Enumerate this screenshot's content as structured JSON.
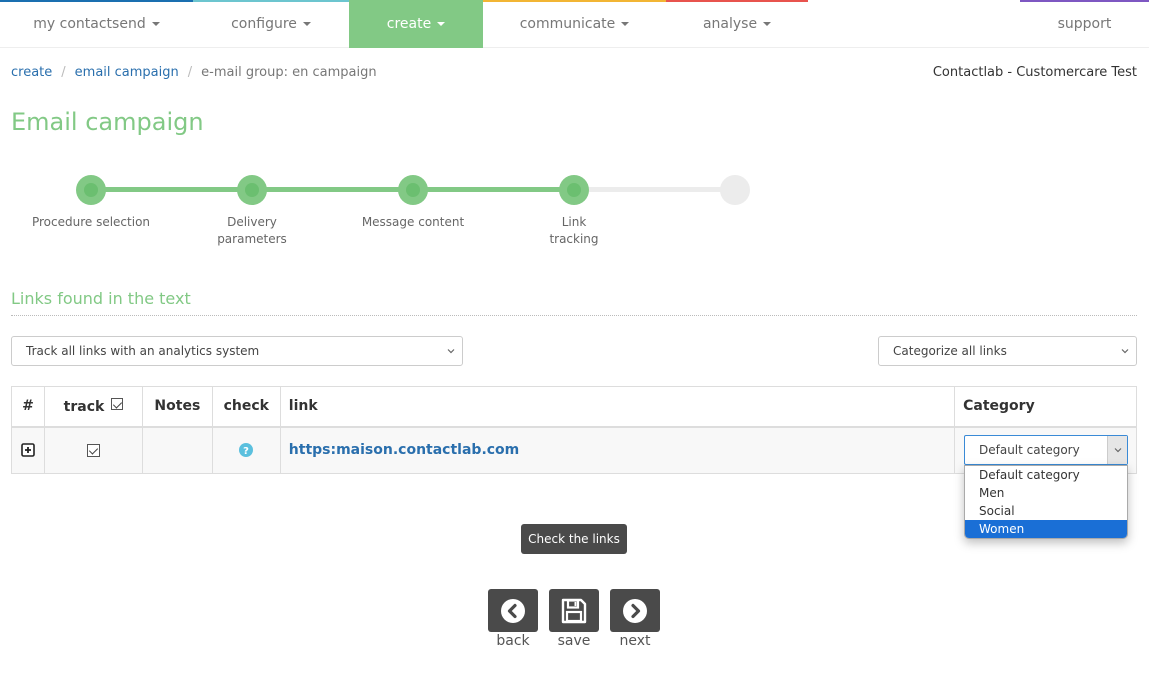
{
  "nav": {
    "items": [
      {
        "label": "my contactsend",
        "has_caret": true,
        "bar_color": "#1a6fb0"
      },
      {
        "label": "configure",
        "has_caret": true,
        "bar_color": "#6cc5cf"
      },
      {
        "label": "create",
        "has_caret": true,
        "bar_color": "#82c985",
        "active": true
      },
      {
        "label": "communicate",
        "has_caret": true,
        "bar_color": "#f2b534"
      },
      {
        "label": "analyse",
        "has_caret": true,
        "bar_color": "#e8534e"
      },
      {
        "label": "support",
        "has_caret": false,
        "bar_color": "#7e57c2"
      }
    ]
  },
  "breadcrumb": {
    "items": [
      "create",
      "email campaign"
    ],
    "current": "e-mail group: en campaign",
    "separator": "/"
  },
  "account": "Contactlab - Customercare Test",
  "page_title": "Email campaign",
  "stepper": {
    "steps": [
      {
        "label_line1": "Procedure selection",
        "label_line2": "",
        "status": "done"
      },
      {
        "label_line1": "Delivery",
        "label_line2": "parameters",
        "status": "done"
      },
      {
        "label_line1": "Message content",
        "label_line2": "",
        "status": "done"
      },
      {
        "label_line1": "Link",
        "label_line2": "tracking",
        "status": "current"
      },
      {
        "label_line1": "",
        "label_line2": "",
        "status": "todo"
      }
    ]
  },
  "section": {
    "title": "Links found in the text",
    "tracking_select": "Track all links with an analytics system",
    "categorize_select": "Categorize all links"
  },
  "table": {
    "headers": {
      "num": "#",
      "track": "track",
      "notes": "Notes",
      "check": "check",
      "link": "link",
      "category": "Category"
    },
    "rows": [
      {
        "tracked": true,
        "notes": "",
        "check_status": "unknown",
        "link": "https:maison.contactlab.com",
        "category": "Default category"
      }
    ]
  },
  "category_dropdown": {
    "options": [
      "Default category",
      "Men",
      "Social",
      "Women"
    ],
    "highlighted": "Women"
  },
  "buttons": {
    "check_links": "Check the links",
    "back": "back",
    "save": "save",
    "next": "next"
  },
  "colors": {
    "brand_green": "#82c985",
    "link_blue": "#2a6fad",
    "dark_button": "#4a4a4a",
    "selection_blue": "#1a6fd6"
  }
}
